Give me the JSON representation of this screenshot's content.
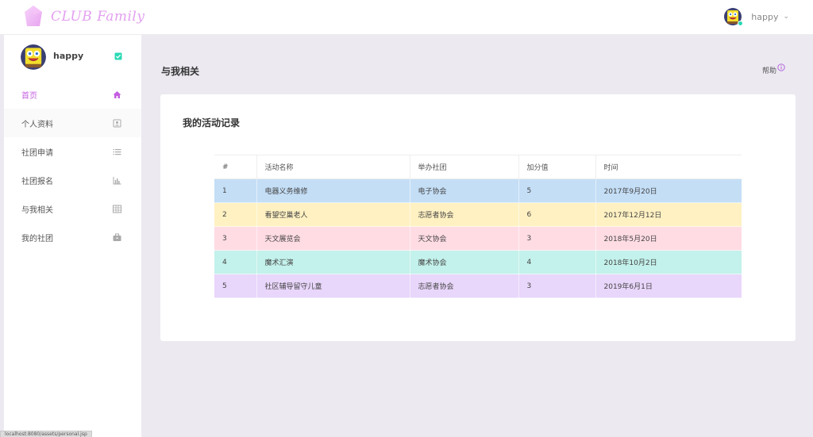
{
  "app": {
    "logo_text": "CLUB Family",
    "brand_color": "#e39ff0"
  },
  "header": {
    "user_name": "happy",
    "caret_icon": "chevron-down-icon"
  },
  "sidebar": {
    "profile": {
      "name": "happy",
      "badge_icon": "verified-check-icon",
      "badge_color": "#2bd9b5"
    },
    "items": [
      {
        "label": "首页",
        "icon": "home-icon",
        "active": true
      },
      {
        "label": "个人资料",
        "icon": "contact-card-icon",
        "active": false
      },
      {
        "label": "社团申请",
        "icon": "list-icon",
        "active": false
      },
      {
        "label": "社团报名",
        "icon": "bar-chart-icon",
        "active": false
      },
      {
        "label": "与我相关",
        "icon": "table-grid-icon",
        "active": false
      },
      {
        "label": "我的社团",
        "icon": "briefcase-icon",
        "active": false
      }
    ],
    "active_color": "#c45fe0"
  },
  "main": {
    "page_title": "与我相关",
    "help_label": "帮助",
    "card_title": "我的活动记录",
    "table": {
      "headers": [
        "#",
        "活动名称",
        "举办社团",
        "加分值",
        "时间"
      ],
      "rows": [
        {
          "cells": [
            "1",
            "电器义务维修",
            "电子协会",
            "5",
            "2017年9月20日"
          ],
          "color": "#c4def6"
        },
        {
          "cells": [
            "2",
            "看望空巢老人",
            "志愿者协会",
            "6",
            "2017年12月12日"
          ],
          "color": "#fff1c2"
        },
        {
          "cells": [
            "3",
            "天文展览会",
            "天文协会",
            "3",
            "2018年5月20日"
          ],
          "color": "#ffdce4"
        },
        {
          "cells": [
            "4",
            "魔术汇演",
            "魔术协会",
            "4",
            "2018年10月2日"
          ],
          "color": "#c3f1eb"
        },
        {
          "cells": [
            "5",
            "社区辅导留守儿童",
            "志愿者协会",
            "3",
            "2019年6月1日"
          ],
          "color": "#e9d6fb"
        }
      ]
    }
  },
  "status_bar": {
    "text": "localhost:8080/assets/personal.jsp"
  }
}
